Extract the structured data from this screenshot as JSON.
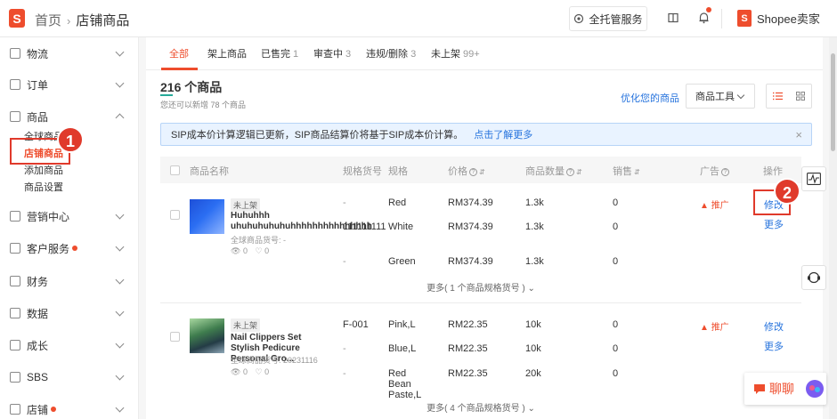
{
  "header": {
    "breadcrumb_home": "首页",
    "breadcrumb_current": "店铺商品",
    "service_button": "全托管服务",
    "brand_name": "Shopee卖家"
  },
  "sidebar": {
    "items": [
      {
        "label": "物流",
        "icon": "truck-icon"
      },
      {
        "label": "订单",
        "icon": "clipboard-icon"
      },
      {
        "label": "商品",
        "icon": "bag-icon"
      },
      {
        "label": "营销中心",
        "icon": "tag-icon"
      },
      {
        "label": "客户服务",
        "icon": "person-icon"
      },
      {
        "label": "财务",
        "icon": "wallet-icon"
      },
      {
        "label": "数据",
        "icon": "chart-icon"
      },
      {
        "label": "成长",
        "icon": "pin-icon"
      },
      {
        "label": "SBS",
        "icon": "box-icon"
      },
      {
        "label": "店铺",
        "icon": "shop-icon"
      }
    ],
    "product_sub": [
      "全球商品",
      "店铺商品",
      "添加商品",
      "商品设置"
    ]
  },
  "tabs": [
    {
      "label": "全部",
      "count": ""
    },
    {
      "label": "架上商品",
      "count": ""
    },
    {
      "label": "已售完",
      "count": "1"
    },
    {
      "label": "审查中",
      "count": "3"
    },
    {
      "label": "违规/删除",
      "count": "3"
    },
    {
      "label": "未上架",
      "count": "99+"
    }
  ],
  "summary": {
    "count_title": "216 个商品",
    "count_sub": "您还可以新增 78 个商品"
  },
  "toolbar": {
    "optimize_link": "优化您的商品",
    "tools_label": "商品工具"
  },
  "banner": {
    "text": "SIP成本价计算逻辑已更新，SIP商品结算价将基于SIP成本价计算。",
    "link": "点击了解更多",
    "close": "×"
  },
  "table": {
    "headers": [
      "商品名称",
      "规格货号",
      "规格",
      "价格",
      "商品数量",
      "销售",
      "广告",
      "操作"
    ]
  },
  "products": [
    {
      "badge": "未上架",
      "name": "Huhuhhh uhuhuhuhuhuhhhhhhhhhhhhhhh",
      "code": "全球商品货号: -",
      "views": "0",
      "likes": "0",
      "promo": "推广",
      "edit": "修改",
      "more_action": "更多",
      "more_variants": "更多( 1 个商品规格货号 )",
      "variants": [
        {
          "sku": "-",
          "spec": "Red",
          "price": "RM374.39",
          "qty": "1.3k",
          "sales": "0"
        },
        {
          "sku": "111111111",
          "spec": "White",
          "price": "RM374.39",
          "qty": "1.3k",
          "sales": "0"
        },
        {
          "sku": "-",
          "spec": "Green",
          "price": "RM374.39",
          "qty": "1.3k",
          "sales": "0"
        }
      ]
    },
    {
      "badge": "未上架",
      "name": "Nail Clippers Set Stylish Pedicure Personal Gro...",
      "code": "全球商品货号: 20231116",
      "views": "0",
      "likes": "0",
      "promo": "推广",
      "edit": "修改",
      "more_action": "更多",
      "more_variants": "更多( 4 个商品规格货号 )",
      "variants": [
        {
          "sku": "F-001",
          "spec": "Pink,L",
          "price": "RM22.35",
          "qty": "10k",
          "sales": "0"
        },
        {
          "sku": "-",
          "spec": "Blue,L",
          "price": "RM22.35",
          "qty": "10k",
          "sales": "0"
        },
        {
          "sku": "-",
          "spec": "Red Bean Paste,L",
          "price": "RM22.35",
          "qty": "20k",
          "sales": "0"
        }
      ]
    }
  ],
  "callouts": [
    "1",
    "2"
  ],
  "chat": {
    "label": "聊聊"
  },
  "colors": {
    "accent": "#ee4d2d",
    "link": "#2673dd",
    "callout": "#e03a2b"
  }
}
